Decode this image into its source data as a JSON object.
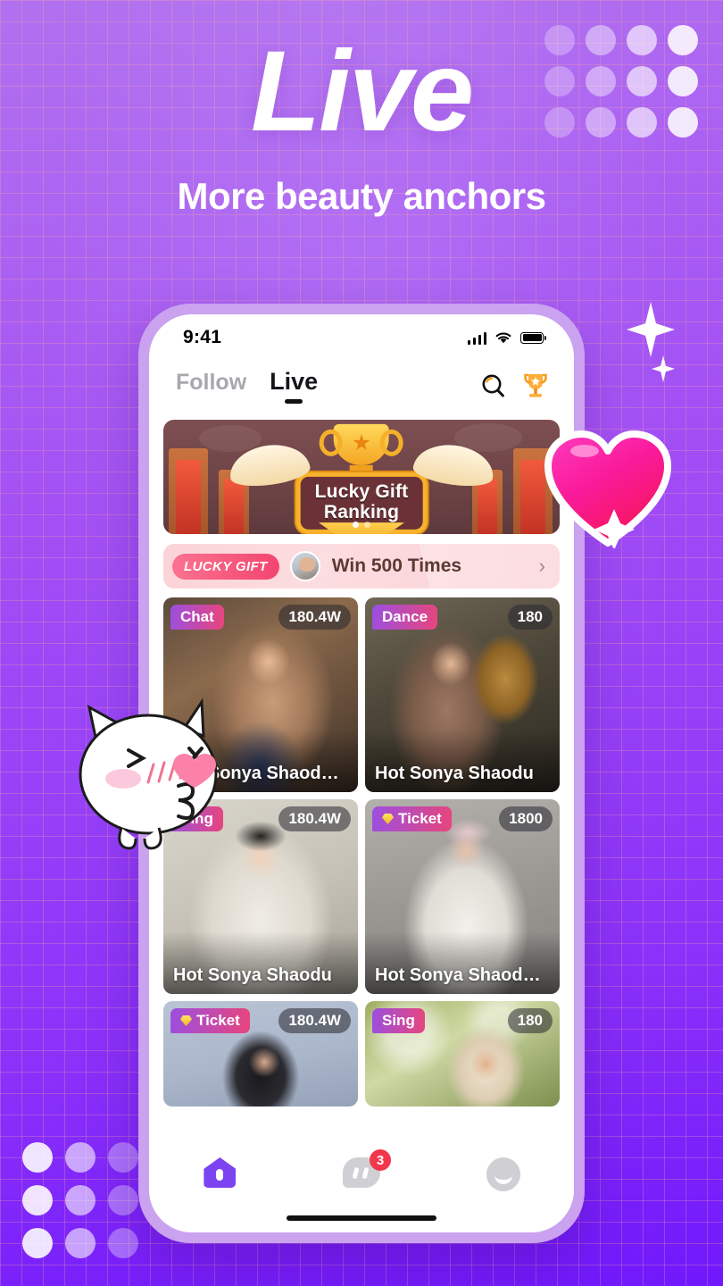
{
  "hero": {
    "title": "Live",
    "subtitle": "More beauty anchors"
  },
  "phone": {
    "status": {
      "time": "9:41",
      "signal_icon": "cellular-bars-icon",
      "wifi_icon": "wifi-icon",
      "battery_icon": "battery-icon"
    },
    "nav": {
      "tabs": [
        {
          "label": "Follow",
          "active": false
        },
        {
          "label": "Live",
          "active": true
        }
      ],
      "search_icon": "search-icon",
      "trophy_icon": "trophy-icon"
    },
    "banner": {
      "title_line1": "Lucky Gift",
      "title_line2": "Ranking",
      "dots": [
        "on",
        "off"
      ]
    },
    "lucky_row": {
      "pill": "LUCKY GIFT",
      "avatar": "user-avatar",
      "text": "Win 500 Times",
      "arrow": "›"
    },
    "cards": [
      {
        "badge": "Chat",
        "gem": false,
        "count": "180.4W",
        "name": "Hot Sonya Shaodu du…"
      },
      {
        "badge": "Dance",
        "gem": false,
        "count": "180",
        "name": "Hot Sonya Shaodu"
      },
      {
        "badge": "Sing",
        "gem": false,
        "count": "180.4W",
        "name": "Hot Sonya Shaodu"
      },
      {
        "badge": "Ticket",
        "gem": true,
        "count": "1800",
        "name": "Hot Sonya Shaodu du…"
      },
      {
        "badge": "Ticket",
        "gem": true,
        "count": "180.4W",
        "name": ""
      },
      {
        "badge": "Sing",
        "gem": false,
        "count": "180",
        "name": ""
      }
    ],
    "tabbar": {
      "home_icon": "home-icon",
      "messages_icon": "chat-bubble-icon",
      "profile_icon": "smiley-face-icon",
      "messages_badge": "3"
    }
  },
  "stickers": {
    "cat": "kissing-cat-sticker",
    "heart": "pink-heart-sticker",
    "sparkles": "sparkle-star"
  },
  "colors": {
    "bg_top": "#b171ef",
    "bg_bottom": "#7018fc",
    "phone_frame": "#caa2ef",
    "accent_purple": "#7c44f0",
    "accent_pink": "#e8457b",
    "badge_red": "#f2374b",
    "gold": "#f5a623"
  }
}
